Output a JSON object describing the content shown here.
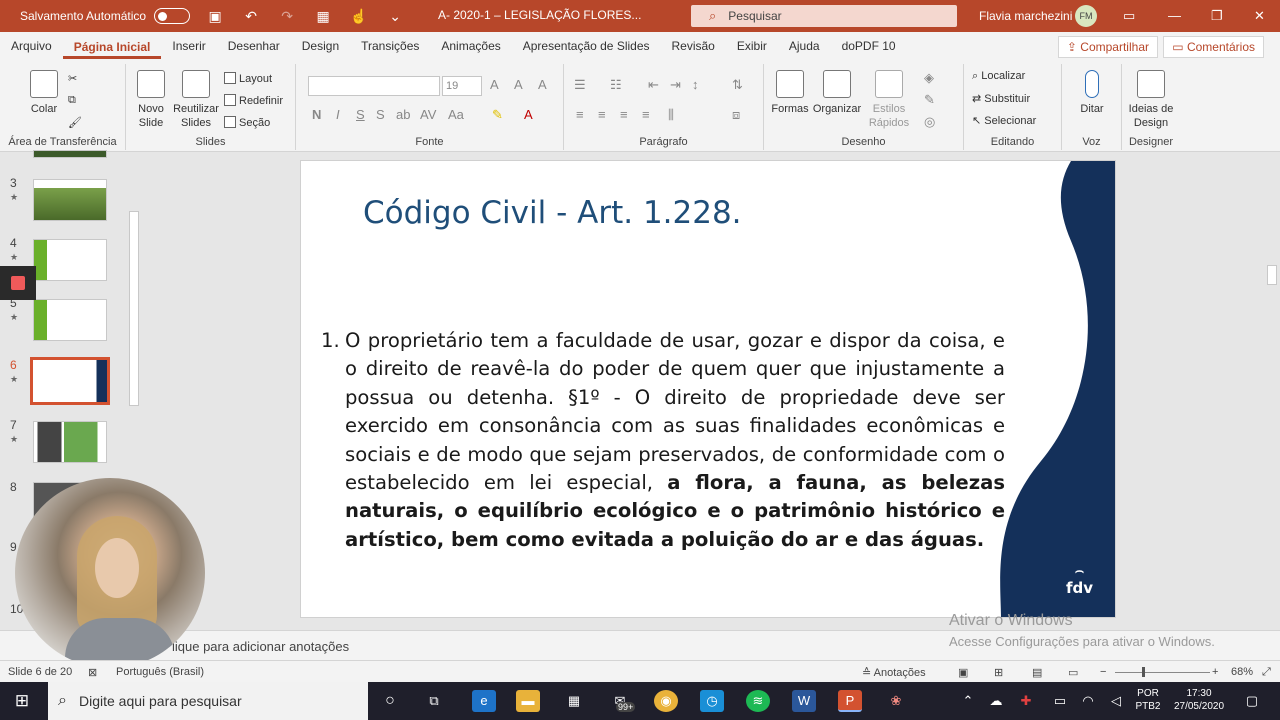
{
  "titlebar": {
    "autosave_label": "Salvamento Automático",
    "doc_title": "A- 2020-1 – LEGISLAÇÃO FLORES...",
    "search_placeholder": "Pesquisar",
    "user_name": "Flavia marchezini",
    "user_initials": "FM"
  },
  "tabs": [
    "Arquivo",
    "Página Inicial",
    "Inserir",
    "Desenhar",
    "Design",
    "Transições",
    "Animações",
    "Apresentação de Slides",
    "Revisão",
    "Exibir",
    "Ajuda",
    "doPDF 10"
  ],
  "share_label": "Compartilhar",
  "comments_label": "Comentários",
  "ribbon": {
    "clipboard": {
      "label": "Área de Transferência",
      "paste": "Colar"
    },
    "slides": {
      "label": "Slides",
      "new_slide": "Novo Slide",
      "reuse": "Reutilizar Slides",
      "layout": "Layout",
      "reset": "Redefinir",
      "section": "Seção"
    },
    "font": {
      "label": "Fonte",
      "size": "19"
    },
    "paragraph": {
      "label": "Parágrafo"
    },
    "drawing": {
      "label": "Desenho",
      "shapes": "Formas",
      "arrange": "Organizar",
      "quick_styles": "Estilos Rápidos"
    },
    "editing": {
      "label": "Editando",
      "find": "Localizar",
      "replace": "Substituir",
      "select": "Selecionar"
    },
    "voice": {
      "label": "Voz",
      "dictate": "Ditar"
    },
    "designer": {
      "label": "Designer",
      "ideas": "Ideias de Design"
    }
  },
  "thumbnails": [
    {
      "num": "3",
      "star": "★"
    },
    {
      "num": "4",
      "star": "★"
    },
    {
      "num": "5",
      "star": "★"
    },
    {
      "num": "6",
      "star": "★"
    },
    {
      "num": "7",
      "star": "★"
    },
    {
      "num": "8",
      "star": ""
    },
    {
      "num": "9",
      "star": ""
    },
    {
      "num": "10",
      "star": ""
    }
  ],
  "slide": {
    "title": "Código Civil - Art. 1.228.",
    "item_number": "1.",
    "body_normal": "O proprietário tem a faculdade de usar, gozar e dispor da coisa, e o direito de reavê-la do poder de quem quer que injustamente a possua ou detenha.  §1º - O direito de propriedade deve ser exercido em consonância com as suas finalidades econômicas e sociais e de modo que sejam preservados, de conformidade com o estabelecido em lei especial, ",
    "body_bold": "a flora, a fauna, as belezas naturais, o equilíbrio ecológico e o patrimônio histórico e artístico, bem como evitada a poluição do ar e das águas.",
    "logo": "fdv"
  },
  "notes_placeholder": "lique para adicionar anotações",
  "watermark": {
    "line1": "Ativar o Windows",
    "line2": "Acesse Configurações para ativar o Windows."
  },
  "status": {
    "slide_count": "Slide 6 de 20",
    "language": "Português (Brasil)",
    "notes_btn": "Anotações",
    "zoom": "68%"
  },
  "taskbar": {
    "search_placeholder": "Digite aqui para pesquisar",
    "badge": "99+",
    "lang1": "POR",
    "lang2": "PTB2",
    "time": "17:30",
    "date": "27/05/2020"
  },
  "colors": {
    "accent": "#b7472a",
    "title_blue": "#1f4e79",
    "slide_panel": "#14305a"
  }
}
